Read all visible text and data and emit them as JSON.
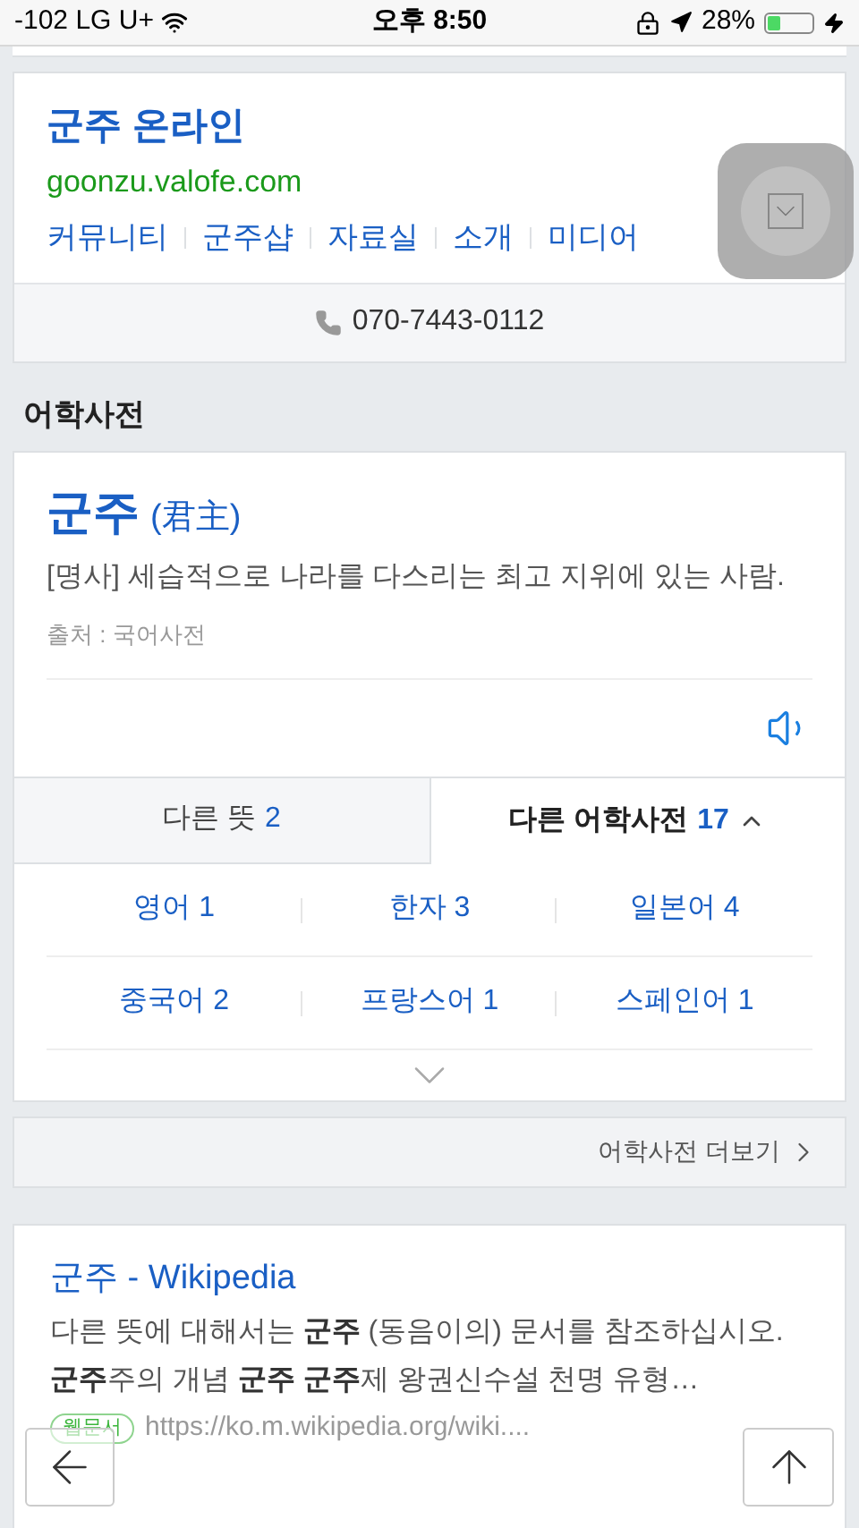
{
  "status_bar": {
    "carrier": "-102 LG U+",
    "time": "오후 8:50",
    "battery_text": "28%",
    "battery": {
      "level": 0.28
    },
    "charging": true
  },
  "site_card": {
    "title": "군주 온라인",
    "url": "goonzu.valofe.com",
    "links": [
      "커뮤니티",
      "군주샵",
      "자료실",
      "소개",
      "미디어"
    ],
    "phone": "070-7443-0112"
  },
  "section_title": "어학사전",
  "dictionary": {
    "word": "군주",
    "hanja": "(君主)",
    "definition": "[명사] 세습적으로 나라를 다스리는 최고 지위에 있는 사람.",
    "source": "출처 : 국어사전",
    "tabs": [
      {
        "label": "다른 뜻",
        "count": "2",
        "selected": false
      },
      {
        "label": "다른 어학사전",
        "count": "17",
        "selected": true
      }
    ],
    "languages": [
      "영어 1",
      "한자 3",
      "일본어 4",
      "중국어 2",
      "프랑스어 1",
      "스페인어 1"
    ],
    "more": "어학사전 더보기"
  },
  "web_result": {
    "title": "군주 - Wikipedia",
    "snippet": "다른 뜻에 대해서는 **군주** (동음이의) 문서를 참조하십시오. **군주**주의 개념 **군주** **군주**제 왕권신수설 천명 유형…",
    "badge": "웹문서",
    "url": "https://ko.m.wikipedia.org/wiki...."
  }
}
